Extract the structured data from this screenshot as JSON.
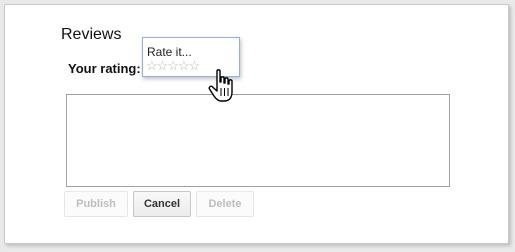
{
  "reviews": {
    "title": "Reviews",
    "rating_label": "Your rating:",
    "rate_popup": {
      "label": "Rate it...",
      "stars_total": 5,
      "stars_filled": 0,
      "star_glyph": "☆"
    },
    "textarea": {
      "value": "",
      "placeholder": ""
    },
    "buttons": {
      "publish": "Publish",
      "cancel": "Cancel",
      "delete": "Delete"
    }
  },
  "cursor": {
    "icon": "hand-pointer-icon"
  },
  "colors": {
    "popup_border": "#8fb1e6",
    "star_empty": "#b8b8b8",
    "disabled_text": "#bdbdbd"
  }
}
